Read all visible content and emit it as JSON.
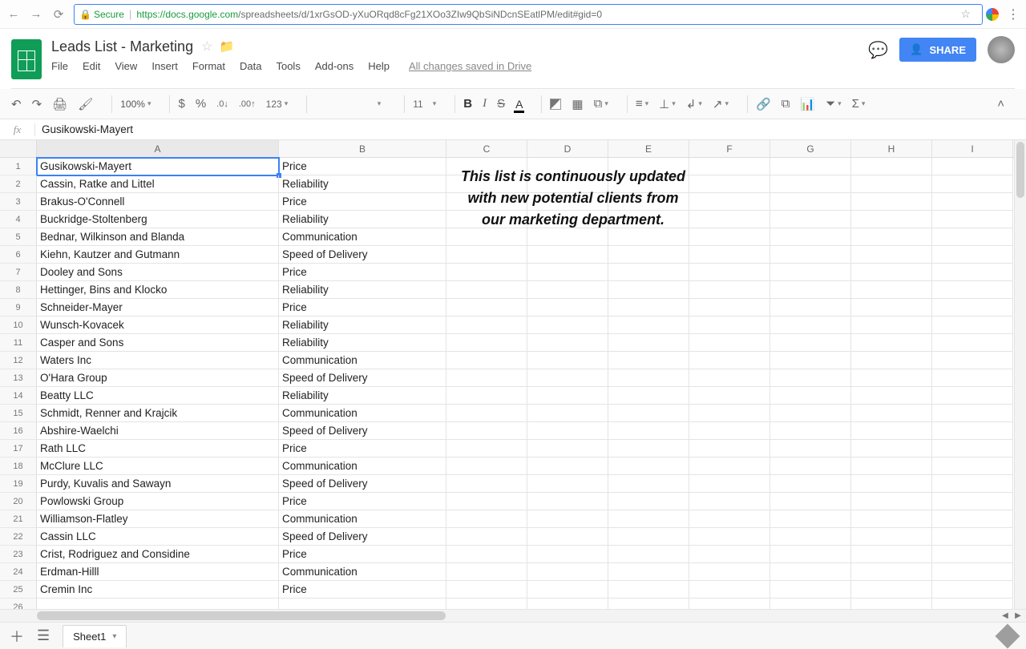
{
  "browser": {
    "secure": "Secure",
    "host": "https://docs.google.com",
    "path": "/spreadsheets/d/1xrGsOD-yXuORqd8cFg21XOo3ZIw9QbSiNDcnSEatlPM/edit#gid=0"
  },
  "doc": {
    "title": "Leads List - Marketing",
    "menu": [
      "File",
      "Edit",
      "View",
      "Insert",
      "Format",
      "Data",
      "Tools",
      "Add-ons",
      "Help"
    ],
    "save_status": "All changes saved in Drive",
    "share": "SHARE"
  },
  "toolbar": {
    "zoom": "100%",
    "more_formats": "123",
    "font_size": "11"
  },
  "formula": {
    "fx": "fx",
    "value": "Gusikowski-Mayert"
  },
  "columns": [
    "A",
    "B",
    "C",
    "D",
    "E",
    "F",
    "G",
    "H",
    "I"
  ],
  "note": "This list is continuously updated with new potential clients from our marketing department.",
  "sheet_tab": "Sheet1",
  "rows": [
    {
      "n": "1",
      "a": "Gusikowski-Mayert",
      "b": "Price"
    },
    {
      "n": "2",
      "a": "Cassin, Ratke and Littel",
      "b": "Reliability"
    },
    {
      "n": "3",
      "a": "Brakus-O'Connell",
      "b": "Price"
    },
    {
      "n": "4",
      "a": "Buckridge-Stoltenberg",
      "b": "Reliability"
    },
    {
      "n": "5",
      "a": "Bednar, Wilkinson and Blanda",
      "b": "Communication"
    },
    {
      "n": "6",
      "a": "Kiehn, Kautzer and Gutmann",
      "b": "Speed of Delivery"
    },
    {
      "n": "7",
      "a": "Dooley and Sons",
      "b": "Price"
    },
    {
      "n": "8",
      "a": "Hettinger, Bins and Klocko",
      "b": "Reliability"
    },
    {
      "n": "9",
      "a": "Schneider-Mayer",
      "b": "Price"
    },
    {
      "n": "10",
      "a": "Wunsch-Kovacek",
      "b": "Reliability"
    },
    {
      "n": "11",
      "a": "Casper and Sons",
      "b": "Reliability"
    },
    {
      "n": "12",
      "a": "Waters Inc",
      "b": "Communication"
    },
    {
      "n": "13",
      "a": "O'Hara Group",
      "b": "Speed of Delivery"
    },
    {
      "n": "14",
      "a": "Beatty LLC",
      "b": "Reliability"
    },
    {
      "n": "15",
      "a": "Schmidt, Renner and Krajcik",
      "b": "Communication"
    },
    {
      "n": "16",
      "a": "Abshire-Waelchi",
      "b": "Speed of Delivery"
    },
    {
      "n": "17",
      "a": "Rath LLC",
      "b": "Price"
    },
    {
      "n": "18",
      "a": "McClure LLC",
      "b": "Communication"
    },
    {
      "n": "19",
      "a": "Purdy, Kuvalis and Sawayn",
      "b": "Speed of Delivery"
    },
    {
      "n": "20",
      "a": "Powlowski Group",
      "b": "Price"
    },
    {
      "n": "21",
      "a": "Williamson-Flatley",
      "b": "Communication"
    },
    {
      "n": "22",
      "a": "Cassin LLC",
      "b": "Speed of Delivery"
    },
    {
      "n": "23",
      "a": "Crist, Rodriguez and Considine",
      "b": "Price"
    },
    {
      "n": "24",
      "a": "Erdman-Hilll",
      "b": "Communication"
    },
    {
      "n": "25",
      "a": "Cremin Inc",
      "b": "Price"
    }
  ]
}
